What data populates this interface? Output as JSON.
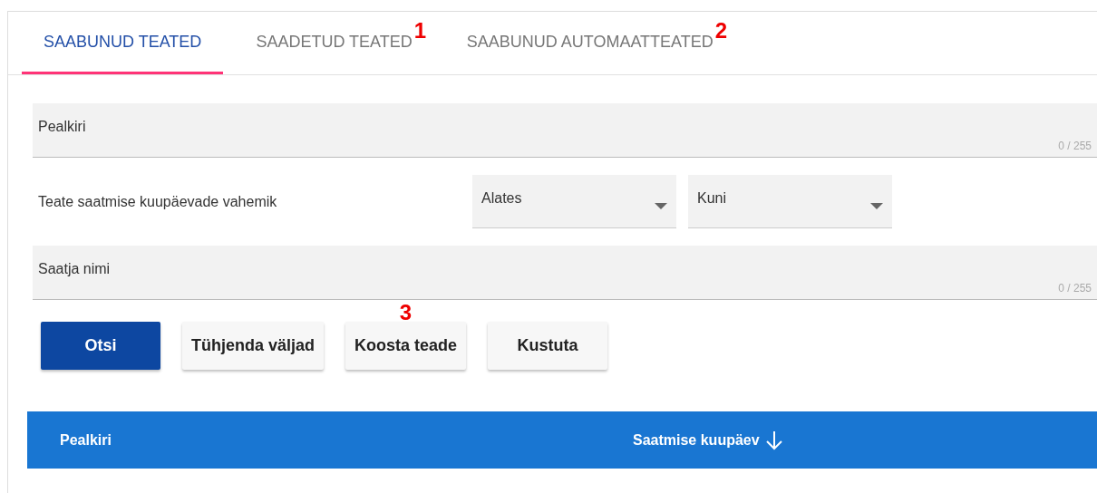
{
  "tabs": [
    {
      "label": "SAABUNUD TEATED",
      "selected": true
    },
    {
      "label": "SAADETUD TEATED",
      "selected": false,
      "annotation": "1"
    },
    {
      "label": "SAABUNUD AUTOMAATTEATED",
      "selected": false,
      "annotation": "2"
    }
  ],
  "filters": {
    "title_field": {
      "placeholder": "Pealkiri",
      "counter": "0 / 255"
    },
    "date_range": {
      "label": "Teate saatmise kuupäevade vahemik",
      "from": {
        "placeholder": "Alates"
      },
      "to": {
        "placeholder": "Kuni"
      }
    },
    "sender_field": {
      "placeholder": "Saatja nimi",
      "counter": "0 / 255"
    }
  },
  "buttons": [
    {
      "label": "Otsi",
      "kind": "primary"
    },
    {
      "label": "Tühjenda väljad",
      "kind": "default"
    },
    {
      "label": "Koosta teade",
      "kind": "default",
      "annotation": "3"
    },
    {
      "label": "Kustuta",
      "kind": "default"
    }
  ],
  "table": {
    "columns": [
      {
        "label": "Pealkiri",
        "sorted": false
      },
      {
        "label": "Saatmise kuupäev",
        "sorted": true
      }
    ]
  }
}
